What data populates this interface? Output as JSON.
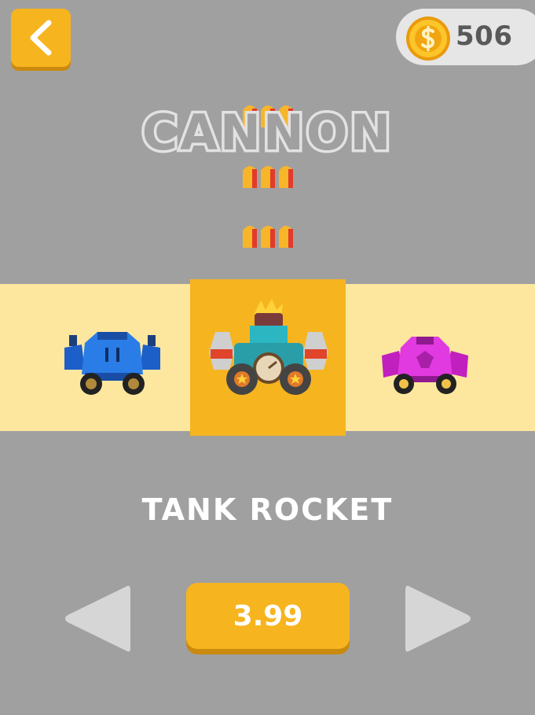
{
  "header": {
    "back_icon": "chevron-left-icon",
    "coins": "506",
    "coin_icon": "coin-icon"
  },
  "weapon": {
    "title": "CANNON",
    "ammo_icon": "bullet-icon"
  },
  "vehicles": {
    "left": {
      "icon": "blue-tank-icon"
    },
    "selected": {
      "icon": "tank-rocket-icon"
    },
    "right": {
      "icon": "pink-car-icon"
    }
  },
  "selected_name": "TANK ROCKET",
  "price": "3.99",
  "nav": {
    "prev_icon": "triangle-left-icon",
    "next_icon": "triangle-right-icon"
  },
  "colors": {
    "background": "#a0a0a0",
    "accent": "#f6b41f",
    "band": "#fde79e"
  }
}
